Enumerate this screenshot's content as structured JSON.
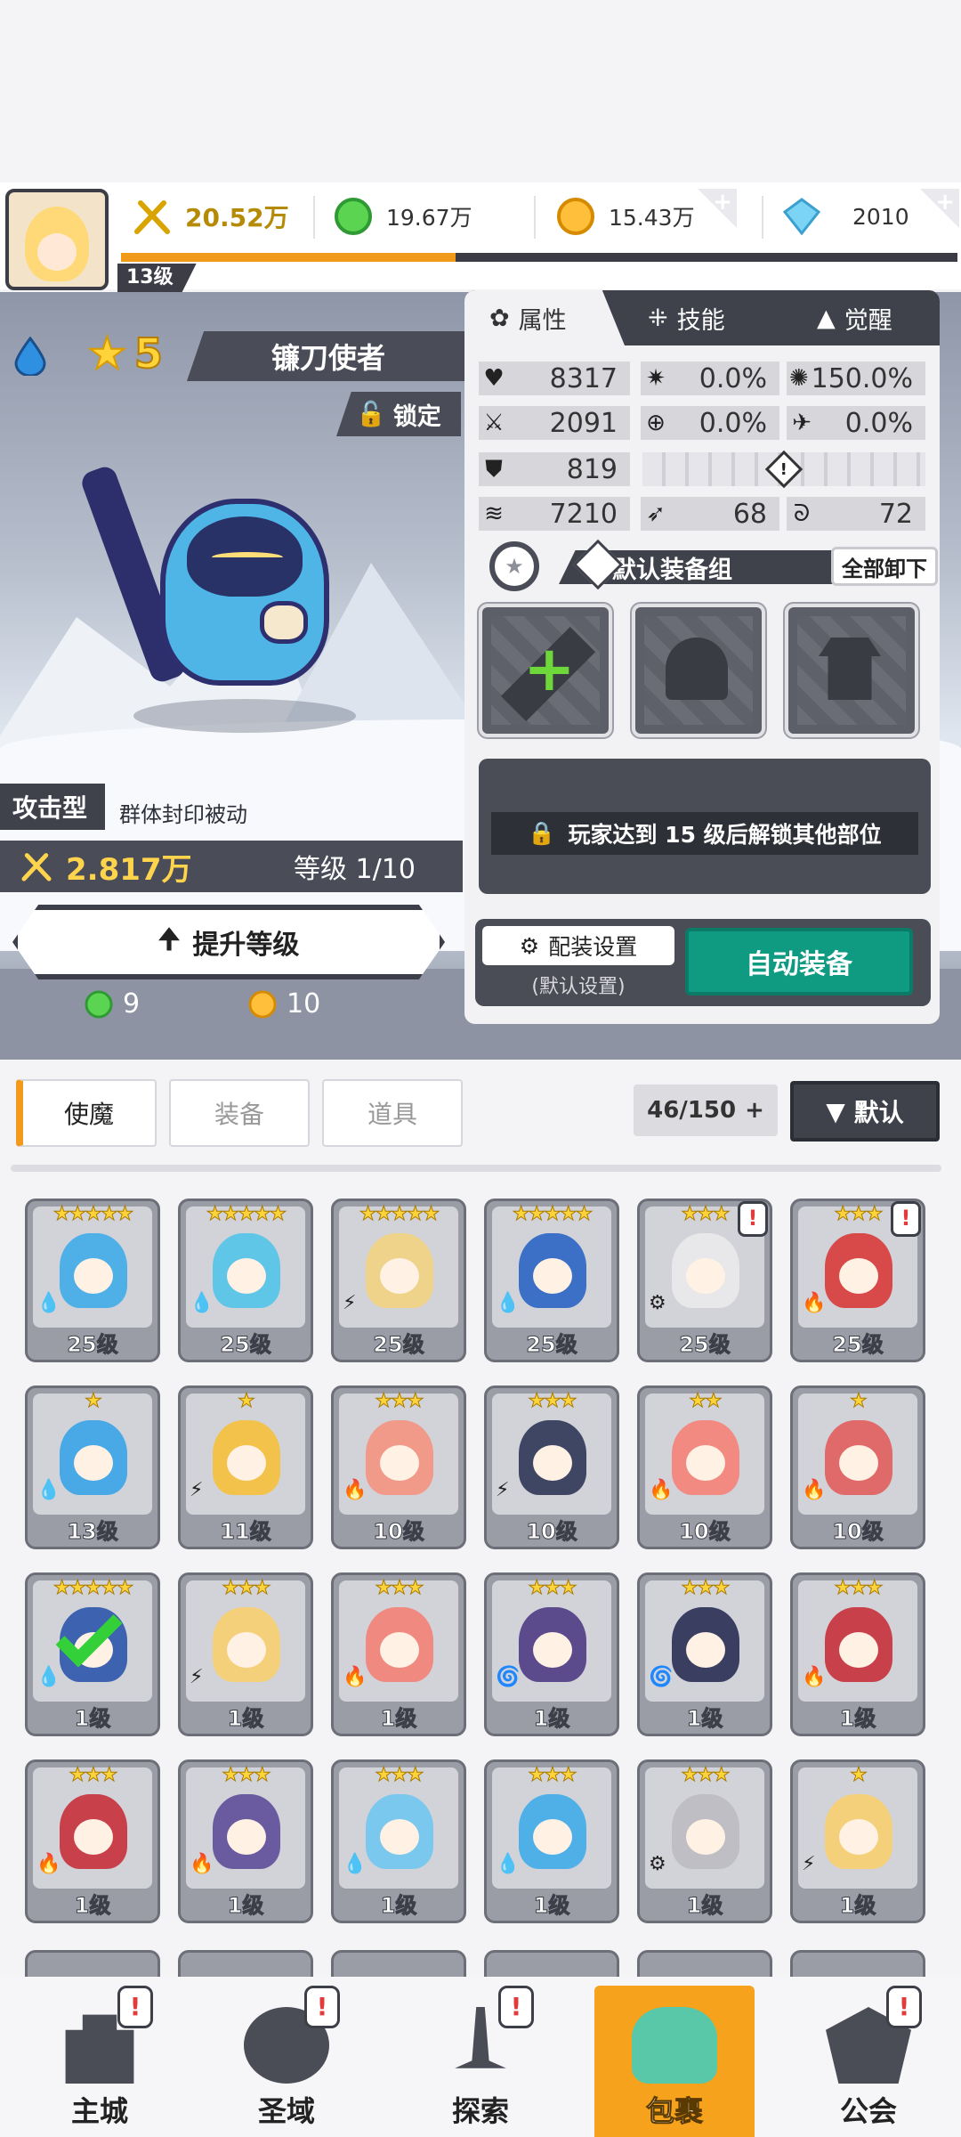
{
  "header": {
    "player_level": "13级",
    "power": "20.52万",
    "green_gems": "19.67万",
    "gold": "15.43万",
    "diamonds": "2010",
    "xp_progress": 0.4
  },
  "hero": {
    "element": "water",
    "star": "5",
    "name": "镰刀使者",
    "lock_label": "锁定",
    "type": "攻击型",
    "passive": "群体封印被动",
    "power": "2.817万",
    "level": "等级 1/10",
    "upgrade_label": "提升等级",
    "cost_green": "9",
    "cost_gold": "10"
  },
  "panel": {
    "tabs": [
      "属性",
      "技能",
      "觉醒"
    ],
    "stats": {
      "hp": "8317",
      "crit": "0.0%",
      "crit_dmg": "150.0%",
      "atk": "2091",
      "hit": "0.0%",
      "dodge": "0.0%",
      "def": "819",
      "speed": "7210",
      "pierce": "68",
      "resist": "72"
    },
    "equip_group": "默认装备组",
    "unload_all": "全部卸下",
    "locked_msg": "玩家达到 15 级后解锁其他部位",
    "config_label": "配装设置",
    "config_sub": "(默认设置)",
    "auto_equip": "自动装备"
  },
  "inventory": {
    "tabs": [
      "使魔",
      "装备",
      "道具"
    ],
    "count": "46/150",
    "sort_label": "默认",
    "cards": [
      {
        "stars": "★★★★★",
        "level": "25级",
        "elem": "💧",
        "color": "#4fb0e8",
        "alert": false
      },
      {
        "stars": "★★★★★",
        "level": "25级",
        "elem": "💧",
        "color": "#5fc6e8",
        "alert": false
      },
      {
        "stars": "★★★★★",
        "level": "25级",
        "elem": "⚡",
        "color": "#f0d38a",
        "alert": false
      },
      {
        "stars": "★★★★★",
        "level": "25级",
        "elem": "💧",
        "color": "#3c6fc6",
        "alert": false
      },
      {
        "stars": "★★★",
        "level": "25级",
        "elem": "⚙",
        "color": "#e8e8ea",
        "alert": true
      },
      {
        "stars": "★★★",
        "level": "25级",
        "elem": "🔥",
        "color": "#d84a4a",
        "alert": true
      },
      {
        "stars": "★",
        "level": "13级",
        "elem": "💧",
        "color": "#49a8e6",
        "alert": false
      },
      {
        "stars": "★",
        "level": "11级",
        "elem": "⚡",
        "color": "#f3c24a",
        "alert": false
      },
      {
        "stars": "★★★",
        "level": "10级",
        "elem": "🔥",
        "color": "#f19a8a",
        "alert": false
      },
      {
        "stars": "★★★",
        "level": "10级",
        "elem": "⚡",
        "color": "#3e4664",
        "alert": false
      },
      {
        "stars": "★★",
        "level": "10级",
        "elem": "🔥",
        "color": "#f28a82",
        "alert": false
      },
      {
        "stars": "★",
        "level": "10级",
        "elem": "🔥",
        "color": "#e06a6a",
        "alert": false
      },
      {
        "stars": "★★★★★",
        "level": "1级",
        "elem": "💧",
        "color": "#3d62b0",
        "alert": false,
        "check": true
      },
      {
        "stars": "★★★",
        "level": "1级",
        "elem": "⚡",
        "color": "#f5d07a",
        "alert": false
      },
      {
        "stars": "★★★",
        "level": "1级",
        "elem": "🔥",
        "color": "#f08a80",
        "alert": false
      },
      {
        "stars": "★★★",
        "level": "1级",
        "elem": "🌀",
        "color": "#5b4a8c",
        "alert": false
      },
      {
        "stars": "★★★",
        "level": "1级",
        "elem": "🌀",
        "color": "#3a3f62",
        "alert": false
      },
      {
        "stars": "★★★",
        "level": "1级",
        "elem": "🔥",
        "color": "#c8404a",
        "alert": false
      },
      {
        "stars": "★★★",
        "level": "1级",
        "elem": "🔥",
        "color": "#c8404a",
        "alert": false
      },
      {
        "stars": "★★★",
        "level": "1级",
        "elem": "🔥",
        "color": "#6a5aa0",
        "alert": false
      },
      {
        "stars": "★★★",
        "level": "1级",
        "elem": "💧",
        "color": "#7ac8ee",
        "alert": false
      },
      {
        "stars": "★★★",
        "level": "1级",
        "elem": "💧",
        "color": "#4fb0e8",
        "alert": false
      },
      {
        "stars": "★★★",
        "level": "1级",
        "elem": "⚙",
        "color": "#bfbec4",
        "alert": false
      },
      {
        "stars": "★",
        "level": "1级",
        "elem": "⚡",
        "color": "#f5d07a",
        "alert": false
      }
    ]
  },
  "nav": [
    {
      "label": "主城",
      "icon": "castle-icon",
      "badge": "!",
      "active": false
    },
    {
      "label": "圣域",
      "icon": "vortex-icon",
      "badge": "!",
      "active": false
    },
    {
      "label": "探索",
      "icon": "sword-icon",
      "badge": "!",
      "active": false
    },
    {
      "label": "包裹",
      "icon": "bag-icon",
      "badge": "",
      "active": true
    },
    {
      "label": "公会",
      "icon": "guild-icon",
      "badge": "!",
      "active": false
    }
  ]
}
